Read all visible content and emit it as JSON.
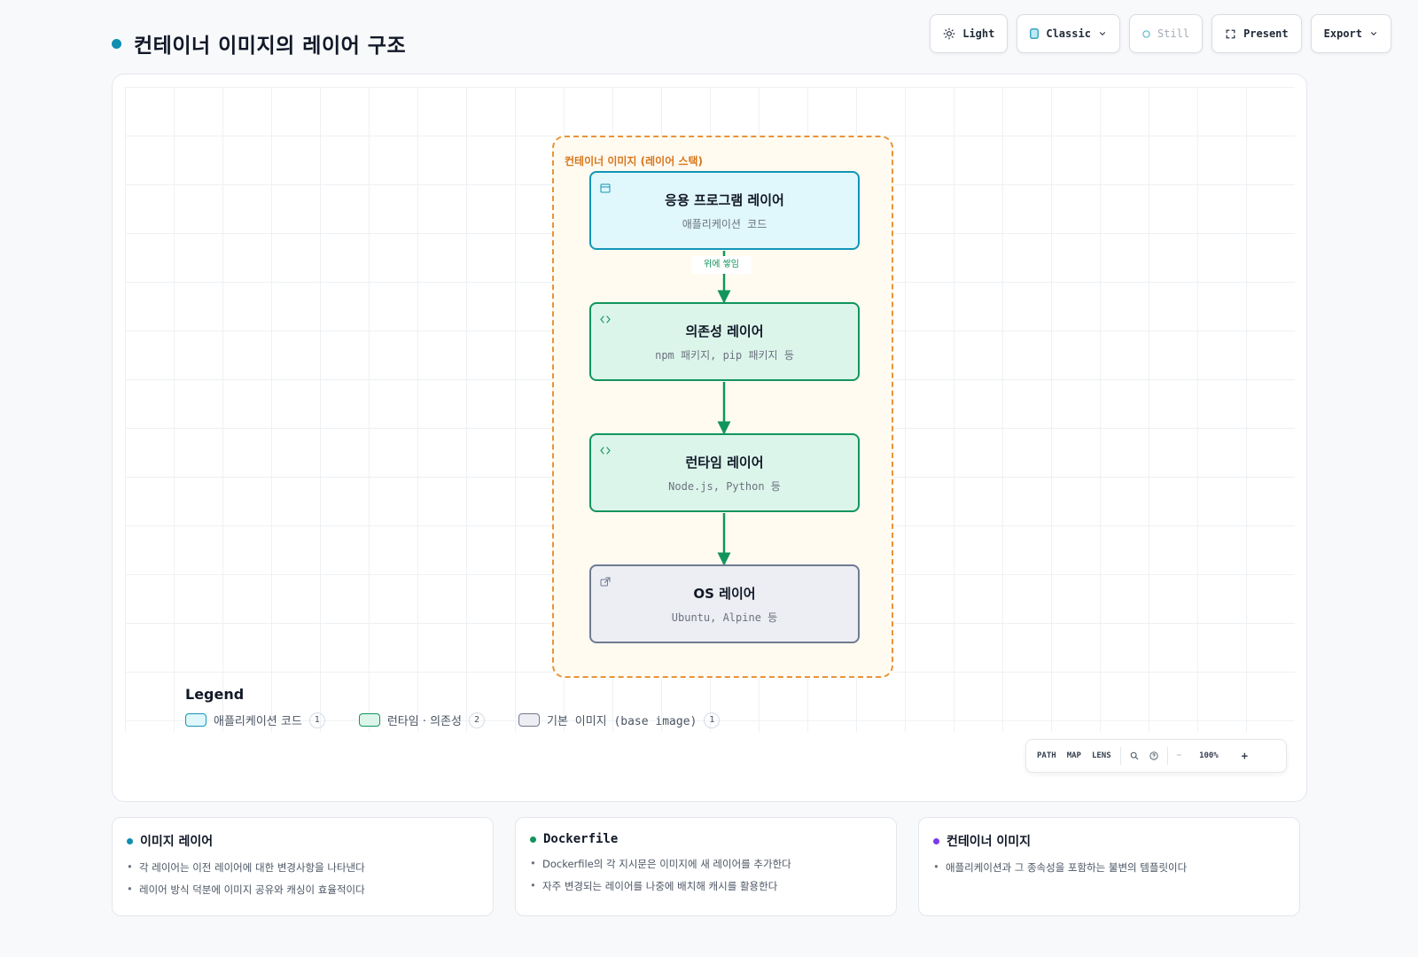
{
  "header": {
    "title": "컨테이너 이미지의 레이어 구조",
    "title_dot_color": "#0e8fb0"
  },
  "toolbar": {
    "light_label": "Light",
    "theme_label": "Classic",
    "still_label": "Still",
    "present_label": "Present",
    "export_label": "Export"
  },
  "diagram": {
    "group_label": "컨테이너 이미지 (레이어 스택)",
    "nodes": [
      {
        "title": "응용 프로그램 레이어",
        "subtitle": "애플리케이션 코드",
        "kind": "app",
        "icon": "window-icon"
      },
      {
        "title": "의존성 레이어",
        "subtitle": "npm 패키지, pip 패키지 등",
        "kind": "dep",
        "icon": "code-icon"
      },
      {
        "title": "런타임 레이어",
        "subtitle": "Node.js, Python 등",
        "kind": "dep",
        "icon": "code-icon"
      },
      {
        "title": "OS 레이어",
        "subtitle": "Ubuntu, Alpine 등",
        "kind": "os",
        "icon": "external-link-icon"
      }
    ],
    "edges": [
      {
        "from": 0,
        "to": 1,
        "label": "위에 쌓임"
      },
      {
        "from": 1,
        "to": 2,
        "label": ""
      },
      {
        "from": 2,
        "to": 3,
        "label": ""
      }
    ],
    "colors": {
      "app": "#1295b8",
      "dep": "#12955d",
      "os": "#707a91",
      "group": "#e8943a"
    }
  },
  "legend": {
    "title": "Legend",
    "items": [
      {
        "label": "애플리케이션 코드",
        "count": "1"
      },
      {
        "label": "런타임 · 의존성",
        "count": "2"
      },
      {
        "label": "기본 이미지 (base image)",
        "count": "1"
      }
    ]
  },
  "view_controls": {
    "path": "PATH",
    "map": "MAP",
    "lens": "LENS",
    "zoom": "100%",
    "minus": "−",
    "plus": "+"
  },
  "cards": [
    {
      "title": "이미지 레이어",
      "dot_color": "#0e8fb0",
      "items": [
        "각 레이어는 이전 레이어에 대한 변경사항을 나타낸다",
        "레이어 방식 덕분에 이미지 공유와 캐싱이 효율적이다"
      ]
    },
    {
      "title": "Dockerfile",
      "dot_color": "#12955d",
      "items": [
        "Dockerfile의 각 지시문은 이미지에 새 레이어를 추가한다",
        "자주 변경되는 레이어를 나중에 배치해 캐시를 활용한다"
      ]
    },
    {
      "title": "컨테이너 이미지",
      "dot_color": "#7c3aed",
      "items": [
        "애플리케이션과 그 종속성을 포함하는 불변의 템플릿이다"
      ]
    }
  ]
}
